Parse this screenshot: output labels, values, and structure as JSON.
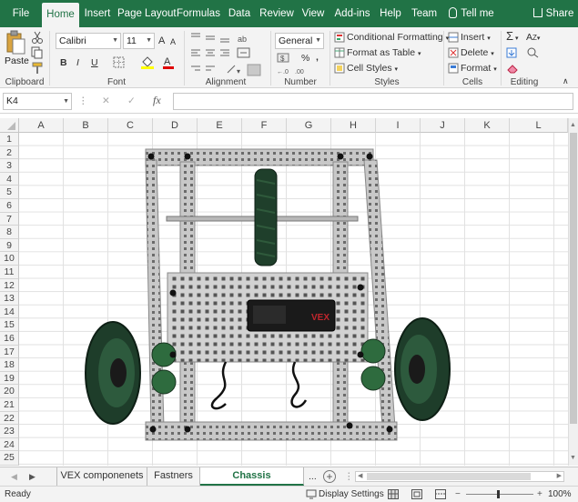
{
  "ribbon_tabs": [
    "File",
    "Home",
    "Insert",
    "Page Layout",
    "Formulas",
    "Data",
    "Review",
    "View",
    "Add-ins",
    "Help",
    "Team"
  ],
  "tell_me": "Tell me",
  "share": "Share",
  "clipboard": {
    "paste": "Paste",
    "label": "Clipboard"
  },
  "font": {
    "name": "Calibri",
    "size": "11",
    "bold": "B",
    "italic": "I",
    "underline": "U",
    "grow": "A",
    "shrink": "A",
    "label": "Font"
  },
  "alignment": {
    "label": "Alignment"
  },
  "number": {
    "format": "General",
    "percent": "%",
    "comma": ",",
    "label": "Number"
  },
  "styles": {
    "conditional": "Conditional Formatting",
    "table": "Format as Table",
    "cell": "Cell Styles",
    "label": "Styles"
  },
  "cells": {
    "insert": "Insert",
    "delete": "Delete",
    "format": "Format",
    "label": "Cells"
  },
  "editing": {
    "label": "Editing"
  },
  "formula_bar": {
    "name_box": "K4",
    "fx": "fx",
    "cancel": "✕",
    "enter": "✓",
    "value": ""
  },
  "columns": [
    "A",
    "B",
    "C",
    "D",
    "E",
    "F",
    "G",
    "H",
    "I",
    "J",
    "K",
    "L"
  ],
  "rows": [
    "1",
    "2",
    "3",
    "4",
    "5",
    "6",
    "7",
    "8",
    "9",
    "10",
    "11",
    "12",
    "13",
    "14",
    "15",
    "16",
    "17",
    "18",
    "19",
    "20",
    "21",
    "22",
    "23",
    "24",
    "25"
  ],
  "sheets": [
    "VEX componenets",
    "Fastners",
    "Chassis Construction"
  ],
  "sheet_more": "...",
  "status": {
    "ready": "Ready",
    "display": "Display Settings",
    "zoom": "100%"
  },
  "image_alt": "VEX chassis with wheels",
  "colors": {
    "brand": "#217346",
    "ribbon": "#f3f3f3"
  }
}
